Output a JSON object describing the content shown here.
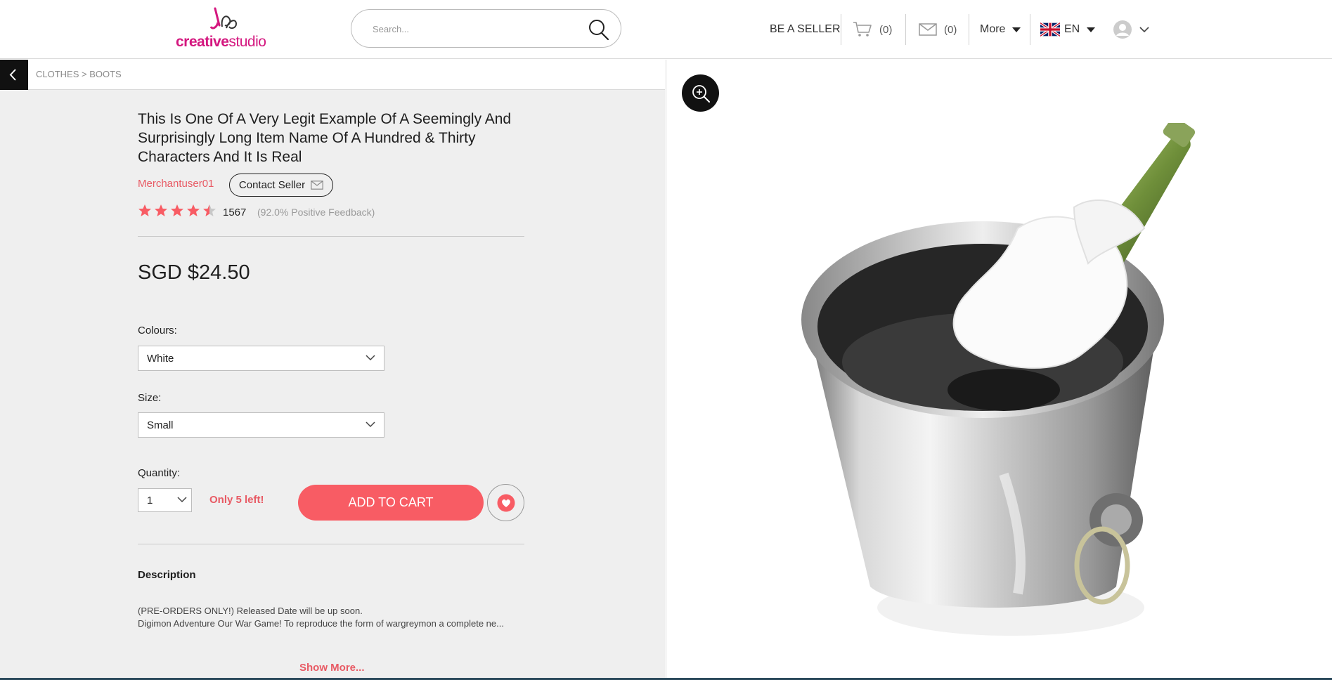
{
  "brand": {
    "part1": "creative",
    "part2": "studio"
  },
  "search": {
    "placeholder": "Search..."
  },
  "nav": {
    "be_seller": "BE A SELLER",
    "cart_count": "(0)",
    "messages_count": "(0)",
    "more_label": "More",
    "language": "EN"
  },
  "breadcrumb": "CLOTHES > BOOTS",
  "product": {
    "title": "This Is One Of A Very Legit Example Of A Seemingly And Surprisingly Long Item Name Of A Hundred & Thirty Characters And It Is Real",
    "merchant": "Merchantuser01",
    "contact_label": "Contact Seller",
    "rating": 4.5,
    "rating_max": 5,
    "review_count": "1567",
    "feedback": "(92.0% Positive Feedback)",
    "price": "SGD $24.50",
    "colours_label": "Colours:",
    "colour_selected": "White",
    "size_label": "Size:",
    "size_selected": "Small",
    "quantity_label": "Quantity:",
    "quantity_selected": "1",
    "stock_note": "Only 5 left!",
    "add_to_cart": "ADD TO CART",
    "description_heading": "Description",
    "description_line1": "(PRE-ORDERS ONLY!) Released Date will be up soon.",
    "description_line2": "Digimon Adventure Our War Game! To reproduce the form of wargreymon a complete ne...",
    "show_more": "Show More..."
  },
  "colors": {
    "accent": "#f85c64",
    "merchant": "#e85a64",
    "brand": "#d4177f"
  }
}
